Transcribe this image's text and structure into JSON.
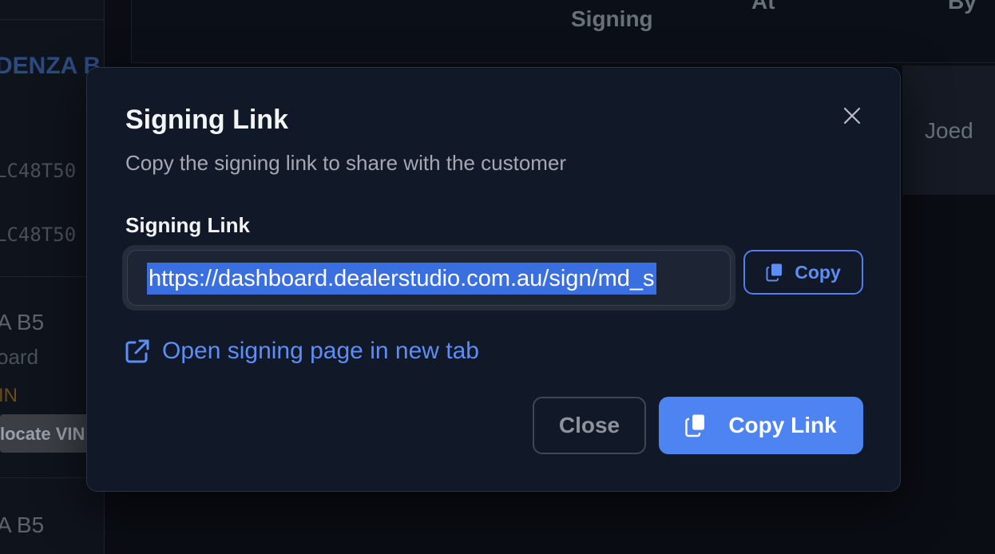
{
  "background": {
    "sidebar": {
      "item1_name": "DENZA B",
      "item1_vin_a": "LC48T50",
      "item1_vin_b": "LC48T50",
      "item2_model": "A B5",
      "item2_sub": "oard",
      "item2_warning": "IN",
      "item2_badge": "locate VIN",
      "item3_model": "A B5"
    },
    "table": {
      "col_signing": "Signing",
      "col_at": "At",
      "col_by": "By",
      "row1_by": "Joed"
    }
  },
  "modal": {
    "title": "Signing Link",
    "description": "Copy the signing link to share with the customer",
    "close_icon": "close-icon",
    "field_label": "Signing Link",
    "link_value": "https://dashboard.dealerstudio.com.au/sign/md_s",
    "copy_button_label": "Copy",
    "copy_icon": "copy-icon",
    "open_link_label": "Open signing page in new tab",
    "open_link_icon": "external-link-icon",
    "close_button_label": "Close",
    "copy_link_button_label": "Copy Link",
    "accent_color": "#4d84f2"
  }
}
